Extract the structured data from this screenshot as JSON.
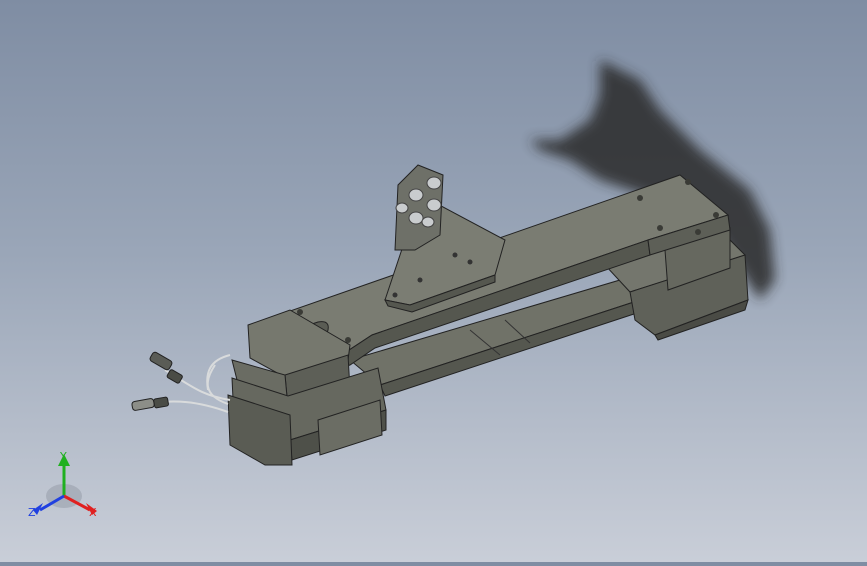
{
  "viewport": {
    "background_top": "#7f8da3",
    "background_bottom": "#c9ced8",
    "part_color": "#6f716c"
  },
  "triad": {
    "x_label": "X",
    "y_label": "Y",
    "z_label": "Z",
    "x_color": "#e02020",
    "y_color": "#20b020",
    "z_color": "#2040e0"
  }
}
